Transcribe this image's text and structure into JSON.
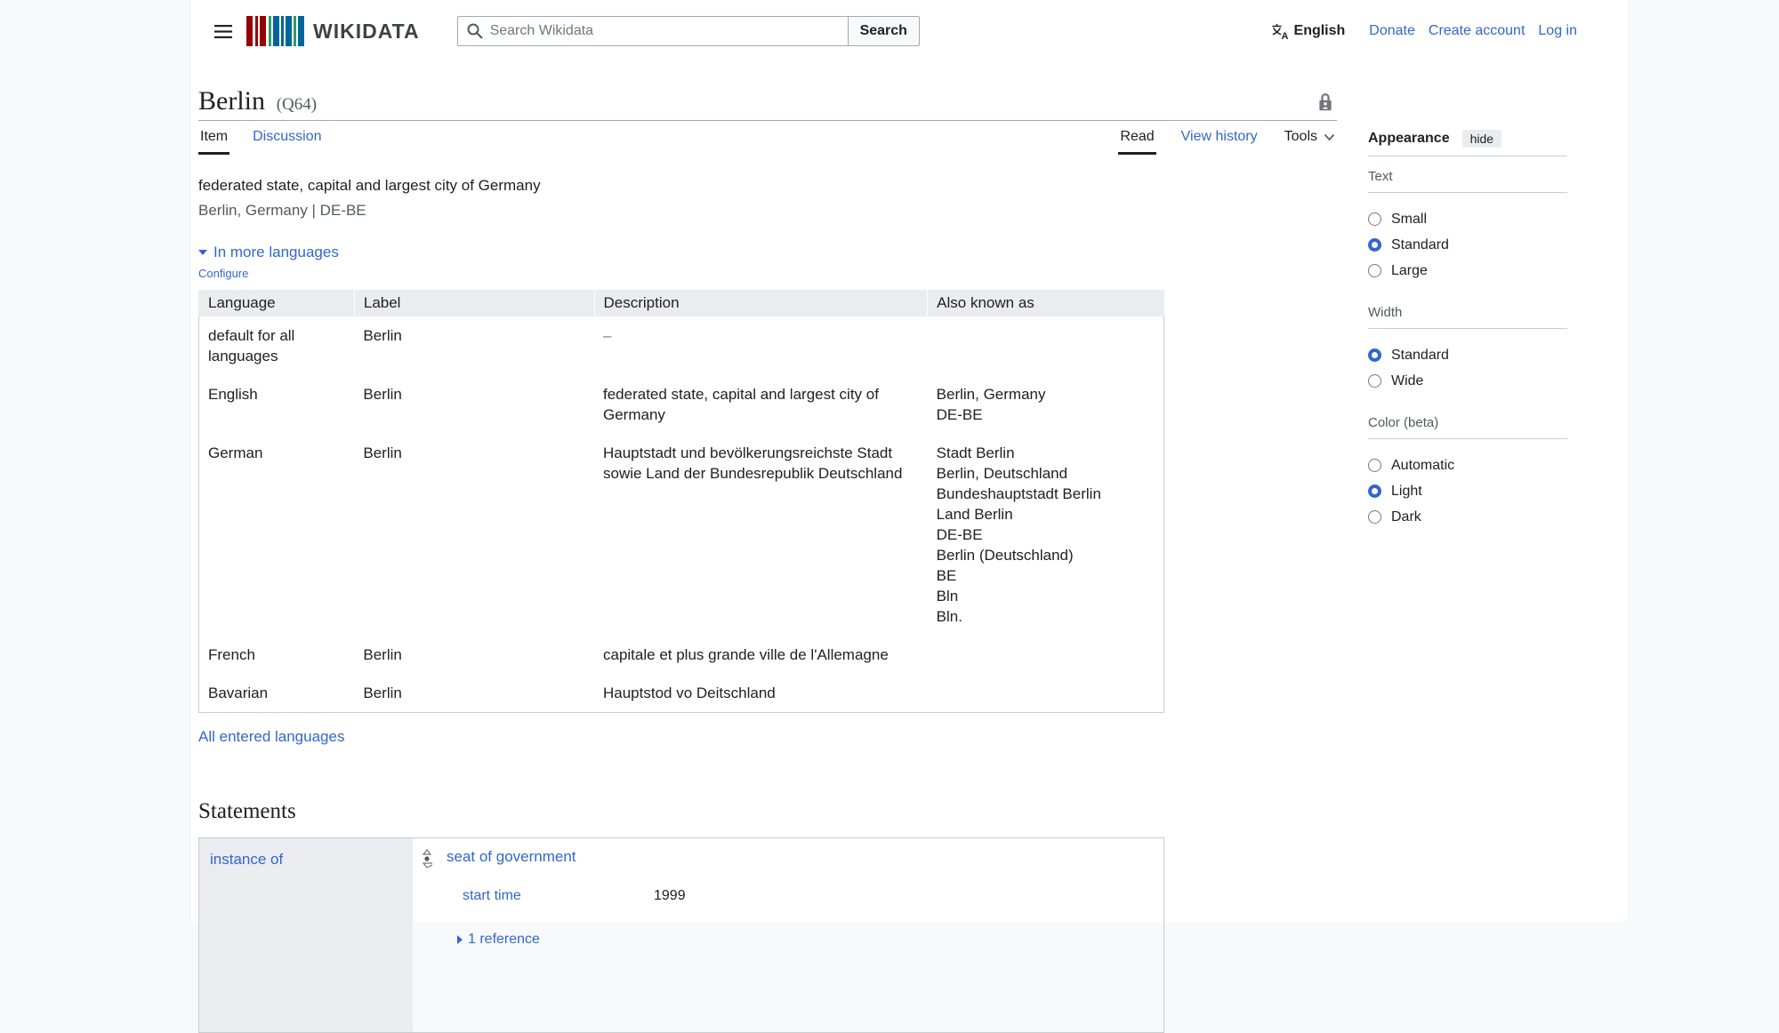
{
  "colors": {
    "link_blue": "#3366cc",
    "accent_radio": "#3366cc",
    "table_header_bg": "#eaecf0",
    "page_bg": "#f8f9fa",
    "border_gray": "#a2a9b1",
    "logo_red": "#990000",
    "logo_green": "#339966",
    "logo_blue": "#006699"
  },
  "icons": {
    "hamburger": "menu-icon",
    "search": "magnifier-icon",
    "language": "translate-icon",
    "lock": "semi-protection-lock-icon",
    "chevron": "chevron-down-icon",
    "collapse": "triangle-down-icon",
    "reference": "triangle-right-icon",
    "rank": "rank-normal-icon"
  },
  "header": {
    "logo_text": "WIKIDATA",
    "search": {
      "placeholder": "Search Wikidata",
      "button_label": "Search"
    },
    "language": {
      "label": "English"
    },
    "links": [
      {
        "label": "Donate"
      },
      {
        "label": "Create account"
      },
      {
        "label": "Log in"
      }
    ]
  },
  "title": {
    "label": "Berlin",
    "qid": "(Q64)"
  },
  "tabs": {
    "left": [
      {
        "label": "Item",
        "active": true
      },
      {
        "label": "Discussion",
        "active": false
      }
    ],
    "right": [
      {
        "label": "Read",
        "active": true
      },
      {
        "label": "View history",
        "active": false
      },
      {
        "label": "Tools",
        "active": false
      }
    ]
  },
  "description": {
    "line1": "federated state, capital and largest city of Germany",
    "line2": "Berlin, Germany | DE-BE"
  },
  "languages_section": {
    "toggle_label": "In more languages",
    "configure_label": "Configure",
    "all_languages_label": "All entered languages",
    "table": {
      "headers": [
        "Language",
        "Label",
        "Description",
        "Also known as"
      ],
      "rows": [
        {
          "language": "default for all languages",
          "label": "Berlin",
          "description": "–",
          "aliases": []
        },
        {
          "language": "English",
          "label": "Berlin",
          "description": "federated state, capital and largest city of Germany",
          "aliases": [
            "Berlin, Germany",
            "DE-BE"
          ]
        },
        {
          "language": "German",
          "label": "Berlin",
          "description": "Hauptstadt und bevölkerungsreichste Stadt sowie Land der Bundesrepublik Deutschland",
          "aliases": [
            "Stadt Berlin",
            "Berlin, Deutschland",
            "Bundeshauptstadt Berlin",
            "Land Berlin",
            "DE-BE",
            "Berlin (Deutschland)",
            "BE",
            "Bln",
            "Bln."
          ]
        },
        {
          "language": "French",
          "label": "Berlin",
          "description": "capitale et plus grande ville de l'Allemagne",
          "aliases": []
        },
        {
          "language": "Bavarian",
          "label": "Berlin",
          "description": "Hauptstod vo Deitschland",
          "aliases": []
        }
      ]
    }
  },
  "statements": {
    "heading": "Statements",
    "items": [
      {
        "property": "instance of",
        "value": "seat of government",
        "qualifiers": [
          {
            "property": "start time",
            "value": "1999"
          }
        ],
        "references_label": "1 reference"
      }
    ]
  },
  "appearance": {
    "heading": "Appearance",
    "hide_label": "hide",
    "sections": [
      {
        "label": "Text",
        "options": [
          {
            "label": "Small",
            "checked": false
          },
          {
            "label": "Standard",
            "checked": true
          },
          {
            "label": "Large",
            "checked": false
          }
        ]
      },
      {
        "label": "Width",
        "options": [
          {
            "label": "Standard",
            "checked": true
          },
          {
            "label": "Wide",
            "checked": false
          }
        ]
      },
      {
        "label": "Color (beta)",
        "options": [
          {
            "label": "Automatic",
            "checked": false
          },
          {
            "label": "Light",
            "checked": true
          },
          {
            "label": "Dark",
            "checked": false
          }
        ]
      }
    ]
  }
}
